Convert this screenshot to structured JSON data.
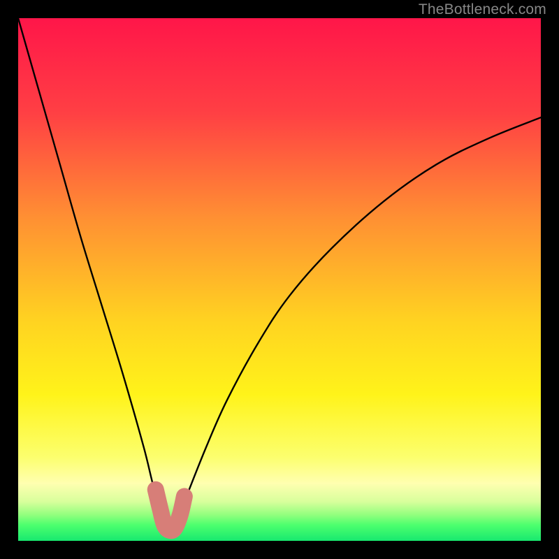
{
  "watermark": {
    "text": "TheBottleneck.com"
  },
  "chart_data": {
    "type": "line",
    "title": "",
    "xlabel": "",
    "ylabel": "",
    "xlim": [
      0,
      100
    ],
    "ylim": [
      0,
      100
    ],
    "grid": false,
    "optimal_x": 29,
    "curve_note": "V-shaped bottleneck curve; minimum (optimal match) around x≈29, rising steeply on both sides.",
    "series": [
      {
        "name": "bottleneck-curve",
        "x": [
          0,
          4,
          8,
          12,
          16,
          20,
          24,
          26,
          28,
          29,
          30,
          32,
          36,
          40,
          46,
          52,
          60,
          70,
          80,
          90,
          100
        ],
        "y": [
          100,
          86,
          72,
          58,
          45,
          32,
          18,
          10,
          4,
          2,
          3,
          8,
          18,
          27,
          38,
          47,
          56,
          65,
          72,
          77,
          81
        ]
      }
    ],
    "highlight_segment": {
      "note": "Pink/coral thick rounded marker at the valley bottom",
      "x": [
        26.3,
        27.2,
        28.0,
        29.0,
        30.0,
        31.0,
        31.8
      ],
      "y": [
        9.8,
        6.0,
        3.0,
        2.0,
        2.5,
        5.0,
        8.5
      ],
      "color": "#d77e78"
    },
    "background_gradient": {
      "type": "vertical",
      "stops": [
        {
          "y_pct": 0,
          "color": "#ff1649"
        },
        {
          "y_pct": 18,
          "color": "#ff3f44"
        },
        {
          "y_pct": 38,
          "color": "#ff8f33"
        },
        {
          "y_pct": 58,
          "color": "#ffd321"
        },
        {
          "y_pct": 72,
          "color": "#fff31a"
        },
        {
          "y_pct": 84,
          "color": "#fcff6e"
        },
        {
          "y_pct": 89,
          "color": "#ffffb0"
        },
        {
          "y_pct": 92.5,
          "color": "#d8ff9c"
        },
        {
          "y_pct": 95,
          "color": "#93ff7e"
        },
        {
          "y_pct": 97,
          "color": "#4cff6e"
        },
        {
          "y_pct": 100,
          "color": "#18e86f"
        }
      ]
    }
  }
}
